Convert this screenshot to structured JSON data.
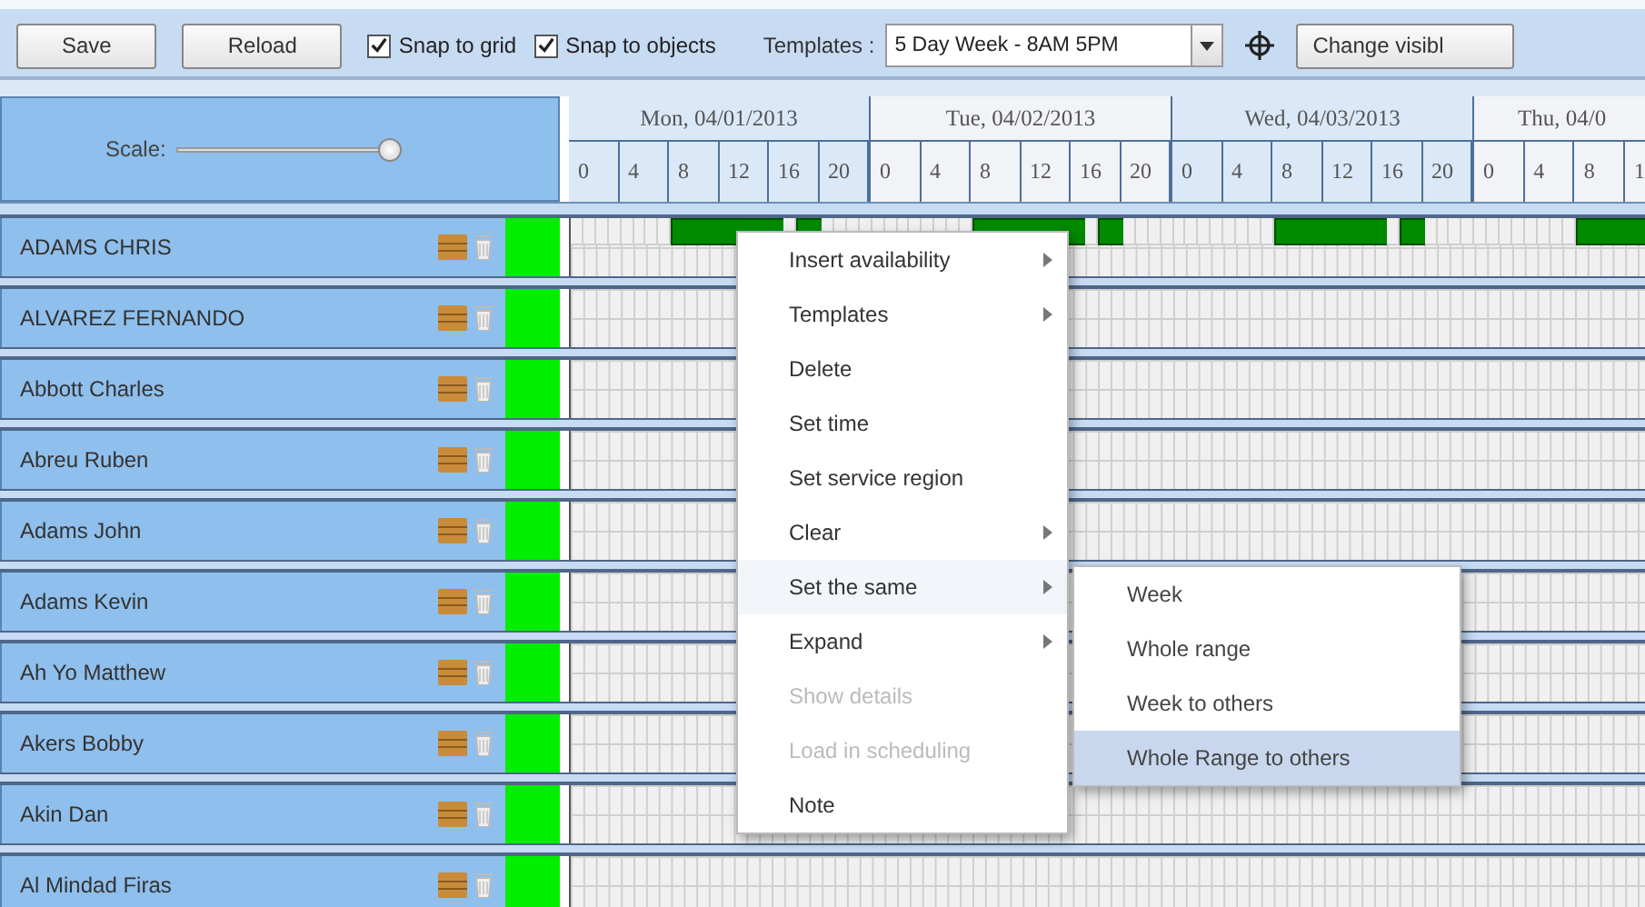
{
  "toolbar": {
    "buttons": [
      {
        "label": "Save"
      },
      {
        "label": "Reload"
      }
    ],
    "checkboxes": [
      {
        "label": "Snap to grid",
        "checked": true
      },
      {
        "label": "Snap to objects",
        "checked": true
      }
    ],
    "templates_label": "Templates :",
    "templates_value": "5 Day Week - 8AM 5PM",
    "visibility_button": "Change visibl"
  },
  "scale": {
    "label": "Scale:",
    "level": 1
  },
  "days": [
    {
      "label": "Mon, 04/01/2013",
      "hours": [
        "0",
        "4",
        "8",
        "12",
        "16",
        "20"
      ]
    },
    {
      "label": "Tue, 04/02/2013",
      "hours": [
        "0",
        "4",
        "8",
        "12",
        "16",
        "20"
      ]
    },
    {
      "label": "Wed, 04/03/2013",
      "hours": [
        "0",
        "4",
        "8",
        "12",
        "16",
        "20"
      ]
    },
    {
      "label": "Thu, 04/0",
      "hours": [
        "0",
        "4",
        "8",
        "1"
      ]
    }
  ],
  "rows": [
    {
      "name": "ADAMS CHRIS",
      "available_hours": [
        [
          false,
          false,
          false,
          false,
          false,
          false,
          false,
          false,
          true,
          true,
          true,
          true,
          true,
          true,
          true,
          true,
          true,
          false,
          true,
          true,
          false,
          false,
          false,
          false
        ],
        [
          false,
          false,
          false,
          false,
          false,
          false,
          false,
          false,
          true,
          true,
          true,
          true,
          true,
          true,
          true,
          true,
          true,
          false,
          true,
          true,
          false,
          false,
          false,
          false
        ],
        [
          false,
          false,
          false,
          false,
          false,
          false,
          false,
          false,
          true,
          true,
          true,
          true,
          true,
          true,
          true,
          true,
          true,
          false,
          true,
          true,
          false,
          false,
          false,
          false
        ],
        [
          false,
          false,
          false,
          false,
          false,
          false,
          false,
          false,
          true,
          true,
          true,
          true,
          true,
          true
        ]
      ]
    },
    {
      "name": "ALVAREZ FERNANDO"
    },
    {
      "name": "Abbott Charles"
    },
    {
      "name": "Abreu Ruben"
    },
    {
      "name": "Adams John"
    },
    {
      "name": "Adams Kevin"
    },
    {
      "name": "Ah Yo Matthew"
    },
    {
      "name": "Akers Bobby"
    },
    {
      "name": "Akin Dan"
    },
    {
      "name": "Al Mindad Firas"
    }
  ],
  "context_menu": {
    "items": [
      {
        "label": "Insert availability",
        "submenu": true,
        "disabled": false
      },
      {
        "label": "Templates",
        "submenu": true,
        "disabled": false
      },
      {
        "label": "Delete",
        "submenu": false,
        "disabled": false
      },
      {
        "label": "Set time",
        "submenu": false,
        "disabled": false
      },
      {
        "label": "Set service region",
        "submenu": false,
        "disabled": false
      },
      {
        "label": "Clear",
        "submenu": true,
        "disabled": false
      },
      {
        "label": "Set the same",
        "submenu": true,
        "disabled": false,
        "expanded": true,
        "children": [
          {
            "label": "Week",
            "selected": false
          },
          {
            "label": "Whole range",
            "selected": false
          },
          {
            "label": "Week to others",
            "selected": false
          },
          {
            "label": "Whole Range to others",
            "selected": true
          }
        ]
      },
      {
        "label": "Expand",
        "submenu": true,
        "disabled": false
      },
      {
        "label": "Show details",
        "submenu": false,
        "disabled": true
      },
      {
        "label": "Load in scheduling",
        "submenu": false,
        "disabled": true
      },
      {
        "label": "Note",
        "submenu": false,
        "disabled": false
      }
    ]
  }
}
